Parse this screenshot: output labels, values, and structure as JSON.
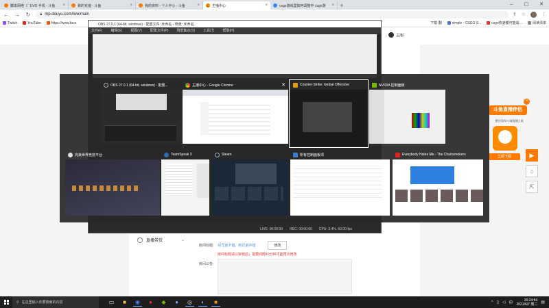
{
  "browser": {
    "tabs": [
      {
        "label": "脚本网络（‘ ’UVO 手机 - 斗鱼",
        "active": false
      },
      {
        "label": "我的充值 - 斗鱼",
        "active": false
      },
      {
        "label": "我的资料 - 个人中心 - 斗鱼",
        "active": false
      },
      {
        "label": "主播中心",
        "active": true
      },
      {
        "label": "csgo游戏里如何调整中 csgo游",
        "active": false
      }
    ],
    "url": "mp.douyu.com/live/main",
    "bookmarks": [
      "Twitch",
      "YouTube",
      "https://www.face",
      "下载·翻",
      "simple - CSGO S...",
      "csgo快速都可能是..."
    ],
    "reading_list": "阅读清单"
  },
  "obs_window": {
    "title": "OBS 27.0.1 (64-bit, windows) - 配置文件: 未命名 - 场景: 未命名",
    "menu": [
      "文件(F)",
      "编辑(E)",
      "视图(V)",
      "配置文件(P)",
      "场景集合(S)",
      "工具(T)",
      "帮助(H)"
    ],
    "status": [
      "LIVE: 00:00:00",
      "REC: 00:00:00",
      "CPU: 3.4%, 60.00 fps"
    ]
  },
  "douyu_page": {
    "user": "主播1",
    "sidebar_live": "直播带货",
    "room_title_label": "房间标题:",
    "room_title_hint": "好兄弟不错，新兄弟不错",
    "edit_button": "修改",
    "warning": "房间标题请以审核后，需要间隔10分钟才能再次修改",
    "notice_label": "房间公告:",
    "ad": {
      "title": "斗鱼直播伴侣",
      "sub": "更好用的PC端直播工具",
      "download": "立即下载"
    }
  },
  "switcher": {
    "windows": [
      {
        "title": "OBS 27.0.1 (64-bit, windows) - 配置...",
        "icon_color": "#303030",
        "shot": "sh-obs",
        "close": false,
        "selected": false
      },
      {
        "title": "主播中心 - Google Chrome",
        "icon_color": "#4285f4",
        "shot": "sh-chrome",
        "close": true,
        "selected": false
      },
      {
        "title": "Counter-Strike: Global Offensive",
        "icon_color": "#e69a1a",
        "shot": "sh-csgo",
        "close": false,
        "selected": true
      },
      {
        "title": "NVIDIA 控制面板",
        "icon_color": "#76b900",
        "shot": "sh-nvidia",
        "close": false,
        "selected": false
      },
      {
        "title": "完美世界竞技平台",
        "icon_color": "#e0e0e0",
        "shot": "sh-dark",
        "close": false,
        "selected": false
      },
      {
        "title": "TeamSpeak 3",
        "icon_color": "#2a6fb5",
        "shot": "sh-ts",
        "close": false,
        "selected": false
      },
      {
        "title": "Steam",
        "icon_color": "#1b2838",
        "shot": "sh-steam",
        "close": false,
        "selected": false
      },
      {
        "title": "所有控制面板项",
        "icon_color": "#3a7bd5",
        "shot": "sh-ctl",
        "close": false,
        "selected": false
      },
      {
        "title": "Everybody Hates Me - The Chainsmokers",
        "icon_color": "#e62117",
        "shot": "sh-yt",
        "close": false,
        "selected": false
      }
    ]
  },
  "taskbar": {
    "search_placeholder": "在这里输入你要搜索的内容",
    "time": "20:34:54",
    "date": "2021/6/7 周二"
  }
}
